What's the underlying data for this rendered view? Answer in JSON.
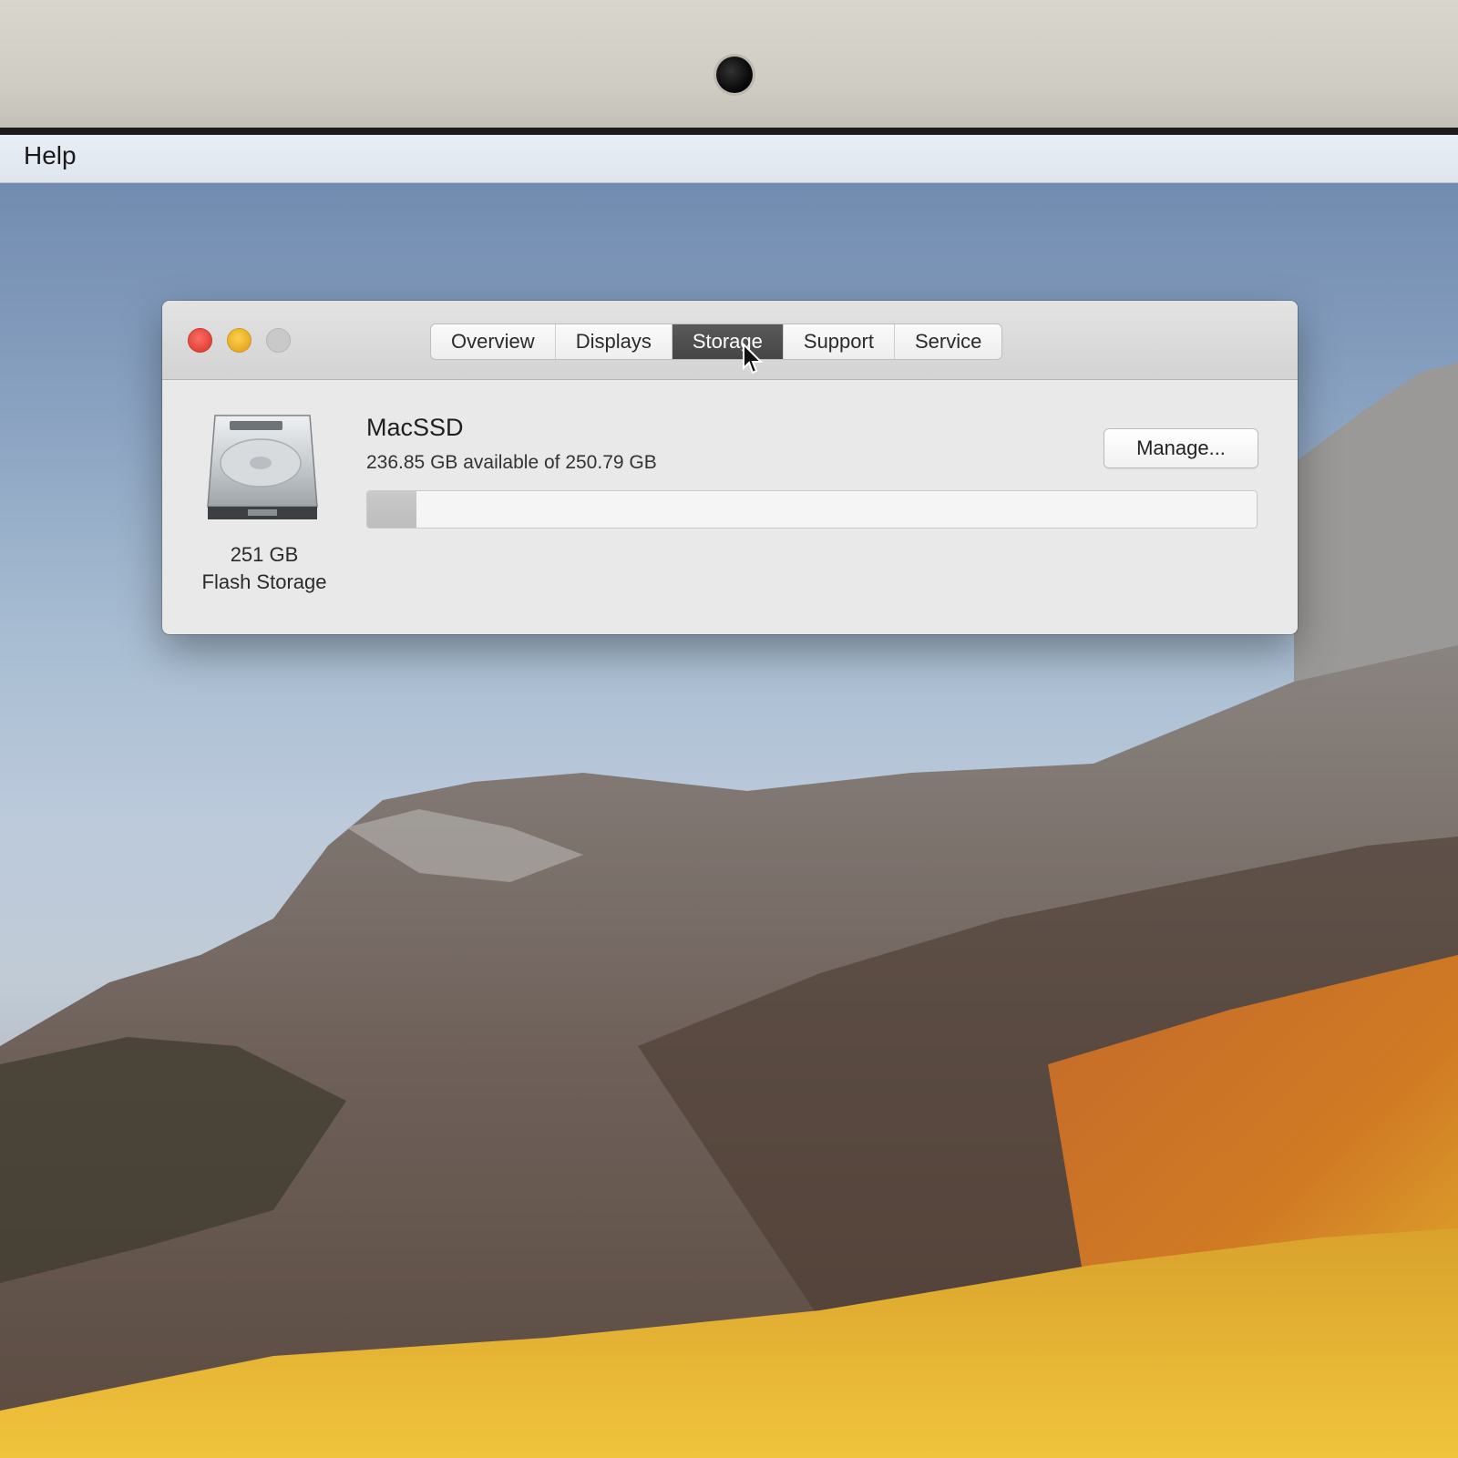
{
  "menubar": {
    "help_label": "Help"
  },
  "window": {
    "tabs": [
      {
        "label": "Overview"
      },
      {
        "label": "Displays"
      },
      {
        "label": "Storage",
        "active": true
      },
      {
        "label": "Support"
      },
      {
        "label": "Service"
      }
    ],
    "drive": {
      "size_label": "251 GB",
      "type_label": "Flash Storage",
      "icon": "hard-drive-icon"
    },
    "volume": {
      "name": "MacSSD",
      "availability": "236.85 GB available of 250.79 GB",
      "used_fraction": 0.0556
    },
    "manage_label": "Manage..."
  },
  "colors": {
    "close": "#e0443a",
    "minimize": "#e6aa25",
    "zoom_disabled": "#c9c9c9",
    "active_tab": "#4a4a4a"
  }
}
